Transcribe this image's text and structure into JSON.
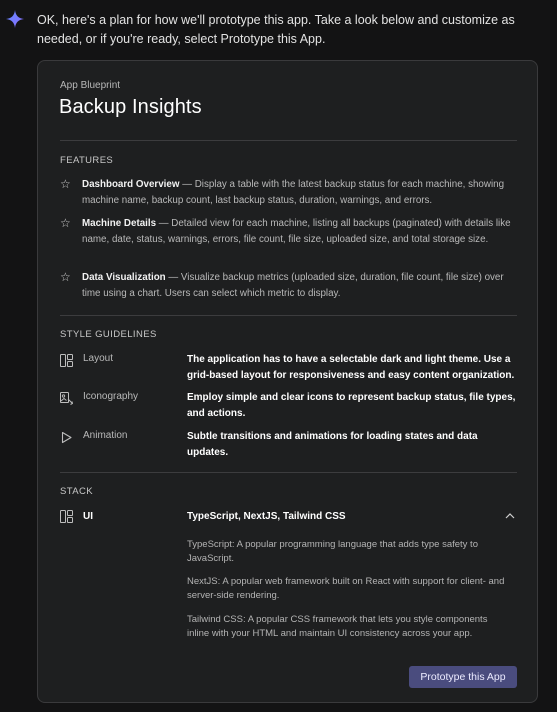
{
  "intro": {
    "text": "OK, here's a plan for how we'll prototype this app. Take a look below and customize as needed, or if you're ready, select Prototype this App."
  },
  "blueprint": {
    "eyebrow": "App Blueprint",
    "title": "Backup Insights",
    "features_heading": "FEATURES",
    "features": [
      {
        "icon": "star-icon",
        "name": "Dashboard Overview",
        "desc": " — Display a table with the latest backup status for each machine, showing machine name, backup count, last backup status, duration, warnings, and errors."
      },
      {
        "icon": "star-icon",
        "name": "Machine Details",
        "desc": " — Detailed view for each machine, listing all backups (paginated) with details like name, date, status, warnings, errors, file count, file size, uploaded size, and total storage size."
      },
      {
        "icon": "star-icon",
        "name": "Data Visualization",
        "desc": " — Visualize backup metrics (uploaded size, duration, file count, file size) over time using a chart. Users can select which metric to display."
      }
    ],
    "style_heading": "STYLE GUIDELINES",
    "style": [
      {
        "icon": "layout-icon",
        "name": "Layout",
        "desc": "The application has to have a selectable dark and light theme. Use a grid-based layout for responsiveness and easy content organization."
      },
      {
        "icon": "iconography-icon",
        "name": "Iconography",
        "desc": "Employ simple and clear icons to represent backup status, file types, and actions."
      },
      {
        "icon": "play-icon",
        "name": "Animation",
        "desc": "Subtle transitions and animations for loading states and data updates."
      }
    ],
    "stack_heading": "STACK",
    "stack": {
      "icon": "layout-icon",
      "name": "UI",
      "value": "TypeScript, NextJS, Tailwind CSS",
      "expanded": true,
      "details": [
        "TypeScript: A popular programming language that adds type safety to JavaScript.",
        "NextJS: A popular web framework built on React with support for client- and server-side rendering.",
        "Tailwind CSS: A popular CSS framework that lets you style components inline with your HTML and maintain UI consistency across your app."
      ]
    },
    "button_label": "Prototype this App"
  },
  "colors": {
    "background": "#131314",
    "card": "#1e1f20",
    "button": "#4a4c7e",
    "sparkle": "#6b8cff"
  }
}
